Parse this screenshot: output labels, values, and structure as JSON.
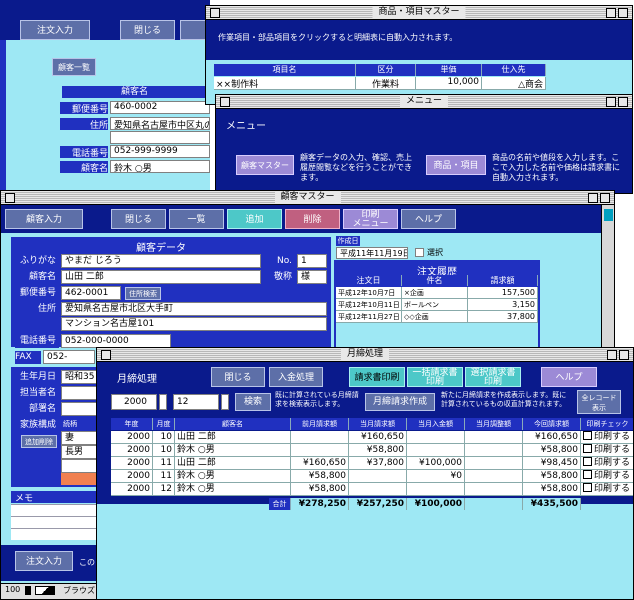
{
  "bg_customer_form": {
    "btn_order": "注文入力",
    "btn_close": "閉じる",
    "btn_list": "顧客一覧",
    "section_title": "顧客名",
    "zip_label": "郵便番号",
    "zip_value": "460-0002",
    "addr_label": "住所",
    "addr_value": "愛知県名古屋市中区丸の内",
    "tel_label": "電話番号",
    "tel_value": "052-999-9999",
    "name_label": "顧客名",
    "name_value": "鈴木  ○男"
  },
  "product_master": {
    "title": "商品・項目マスター",
    "instruction": "作業項目・部品項目をクリックすると明細表に自動入力されます。",
    "col_item": "項目名",
    "col_kind": "区分",
    "col_price": "単価",
    "col_vendor": "仕入先",
    "row_item": "××制作料",
    "row_kind": "作業料",
    "row_price": "10,000",
    "row_vendor": "△商会"
  },
  "menu": {
    "title": "メニュー",
    "header": "メニュー",
    "btn_customer": "顧客マスター",
    "desc_customer": "顧客データの入力、確認、売上履歴閲覧などを行うことができます。",
    "btn_product": "商品・項目",
    "desc_product": "商品の名前や値段を入力します。ここで入力した名前や価格は請求書に自動入力されます。"
  },
  "customer_master": {
    "title": "顧客マスター",
    "toolbar": [
      "顧客入力",
      "閉じる",
      "一覧",
      "追加",
      "削除",
      "印刷\nメニュー",
      "ヘルプ"
    ],
    "section": "顧客データ",
    "furigana_label": "ふりがな",
    "furigana": "やまだ  じろう",
    "no_label": "No.",
    "no_value": "1",
    "name_label": "顧客名",
    "name": "山田  二郎",
    "honor_label": "敬称",
    "honor": "様",
    "zip_label": "郵便番号",
    "zip": "462-0001",
    "zip_btn": "住所検索",
    "addr_label": "住所",
    "addr1": "愛知県名古屋市北区大手町",
    "addr2": "マンション名古屋101",
    "tel_label": "電話番号",
    "tel": "052-000-0000",
    "fax_label": "FAX",
    "fax": "052-",
    "birth_label": "生年月日",
    "birth": "昭和35",
    "staff_label": "担当者名",
    "dept_label": "部署名",
    "family_label": "家族構成",
    "family_btn": "追加削除",
    "family_col": "続柄",
    "family": [
      "妻",
      "長男"
    ],
    "memo_label": "メモ",
    "created_label": "作成日",
    "created": "平成11年11月19日",
    "select_label": "選択",
    "history_title": "注文履歴",
    "history_cols": [
      "注文日",
      "件名",
      "請求額"
    ],
    "history": [
      [
        "平成12年10月7日",
        "×企画",
        "157,500"
      ],
      [
        "平成12年10月11日",
        "ボールペン",
        "3,150"
      ],
      [
        "平成12年11月27日",
        "◇◇企画",
        "37,800"
      ]
    ],
    "bottom_btn": "注文入力",
    "bottom_text": "この",
    "zoom": "100",
    "browse": "ブラウズ"
  },
  "monthly": {
    "title": "月締処理",
    "header": "月締処理",
    "btn_close": "閉じる",
    "btn_payment": "入金処理",
    "btn_print_bill": "請求書印刷",
    "btn_print_list": "一括請求書\n印刷",
    "btn_print_sel": "選択請求書\n印刷",
    "btn_help": "ヘルプ",
    "year": "2000",
    "month": "12",
    "btn_search": "検索",
    "desc_search": "既に計算されている月締請求を検索表示します。",
    "btn_create": "月締請求作成",
    "desc_create": "新たに月締請求を作成表示します。既に計算されているもの収直計算されます。",
    "btn_all": "全レコード\n表示",
    "cols": [
      "年度",
      "月度",
      "顧客名",
      "前月請求額",
      "当月請求額",
      "当月入金額",
      "当月調整額",
      "今回請求額",
      "印刷チェック"
    ],
    "rows": [
      [
        "2000",
        "10",
        "山田  二郎",
        "",
        "¥160,650",
        "",
        "",
        "¥160,650",
        "印刷する"
      ],
      [
        "2000",
        "10",
        "鈴木  ○男",
        "",
        "¥58,800",
        "",
        "",
        "¥58,800",
        "印刷する"
      ],
      [
        "2000",
        "11",
        "山田  二郎",
        "¥160,650",
        "¥37,800",
        "¥100,000",
        "",
        "¥98,450",
        "印刷する"
      ],
      [
        "2000",
        "11",
        "鈴木  ○男",
        "¥58,800",
        "",
        "¥0",
        "",
        "¥58,800",
        "印刷する"
      ],
      [
        "2000",
        "12",
        "鈴木  ○男",
        "¥58,800",
        "",
        "",
        "",
        "¥58,800",
        "印刷する"
      ]
    ],
    "total_label": "合計",
    "totals": [
      "¥278,250",
      "¥257,250",
      "¥100,000",
      "",
      "¥435,500"
    ]
  }
}
